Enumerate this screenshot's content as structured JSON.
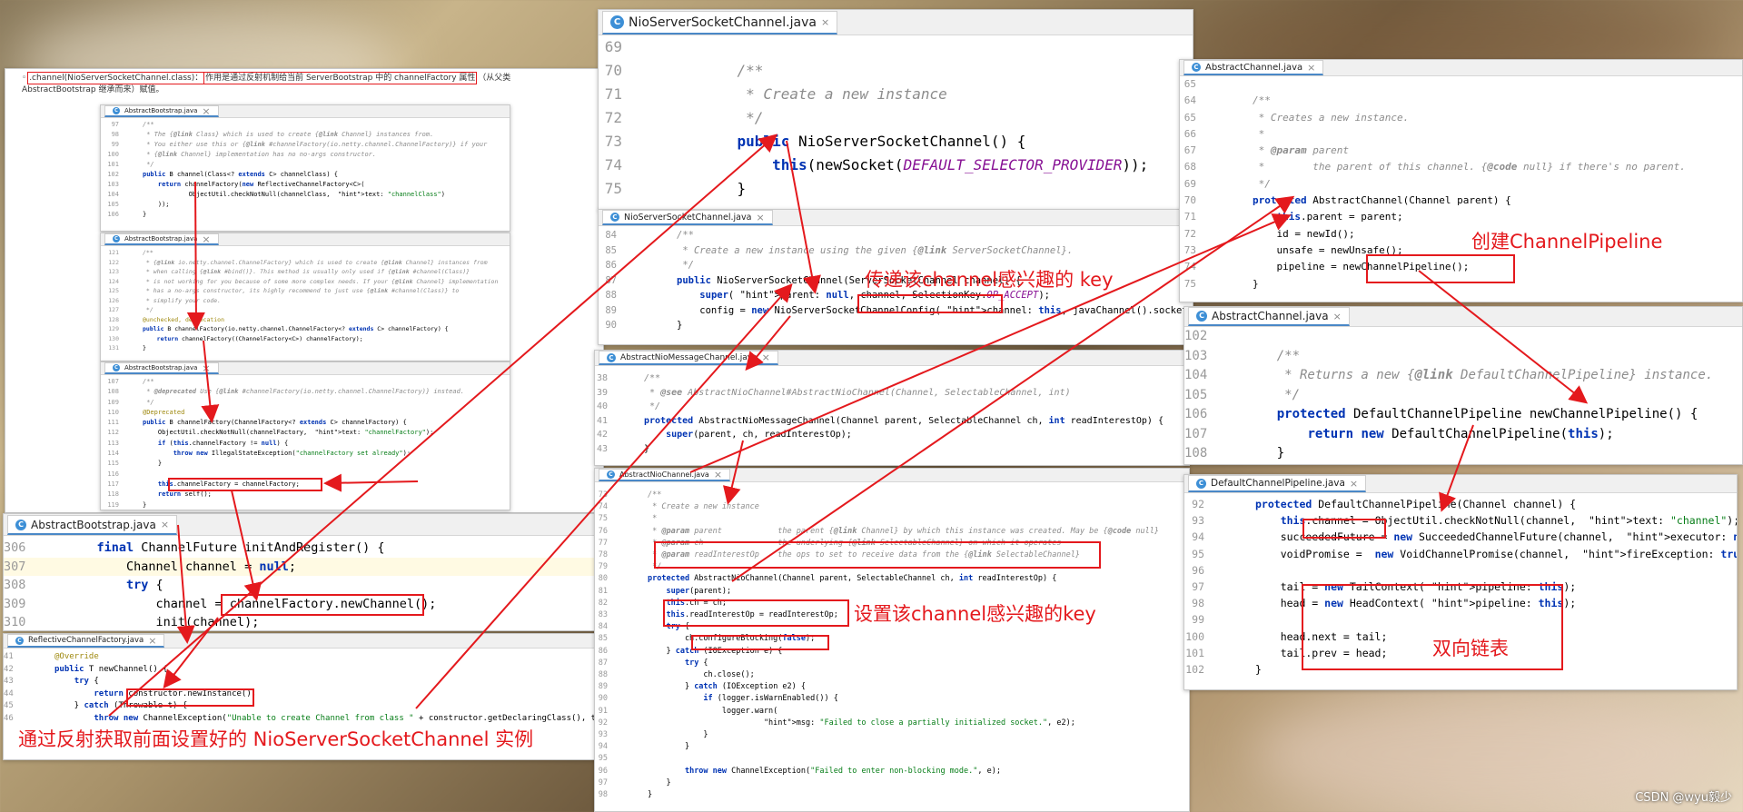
{
  "watermark": "CSDN @wyu毅少",
  "doc_note": {
    "bullet": "◦",
    "prefix": ".channel(NioServerSocketChannel.class)：",
    "text": "作用是通过反射机制给当前 ServerBootstrap 中的 channelFactory 属性",
    "suffix": "（从父类 AbstractBootstrap 继承而来）赋值。"
  },
  "tabs": {
    "abstract_bootstrap": "AbstractBootstrap.java",
    "nio_server_socket_channel": "NioServerSocketChannel.java",
    "abstract_nio_message_channel": "AbstractNioMessageChannel.java",
    "abstract_nio_channel": "AbstractNioChannel.java",
    "reflective_channel_factory": "ReflectiveChannelFactory.java",
    "abstract_channel": "AbstractChannel.java",
    "default_channel_pipeline": "DefaultChannelPipeline.java",
    "close": "×",
    "file_icon": "C"
  },
  "notes": {
    "pass_key": "传递该channel感兴趣的 key",
    "set_key": "设置该channel感兴趣的key",
    "create_pipeline": "创建ChannelPipeline",
    "linked_list": "双向链表",
    "reflect": "通过反射获取前面设置好的 NioServerSocketChannel 实例"
  },
  "ab_small_1": [
    {
      "n": "97",
      "t": "/**"
    },
    {
      "n": "98",
      "t": " * The {@link Class} which is used to create {@link Channel} instances from."
    },
    {
      "n": "99",
      "t": " * You either use this or {@link #channelFactory(io.netty.channel.ChannelFactory)} if your"
    },
    {
      "n": "100",
      "t": " * {@link Channel} implementation has no no-args constructor."
    },
    {
      "n": "101",
      "t": " */"
    },
    {
      "n": "102",
      "t": "public B channel(Class<? extends C> channelClass) {"
    },
    {
      "n": "103",
      "t": "    return channelFactory(new ReflectiveChannelFactory<C>("
    },
    {
      "n": "104",
      "t": "            ObjectUtil.checkNotNull(channelClass,  text: \"channelClass\")"
    },
    {
      "n": "105",
      "t": "    ));"
    },
    {
      "n": "106",
      "t": "}"
    }
  ],
  "ab_small_2": [
    {
      "n": "121",
      "t": "/**"
    },
    {
      "n": "122",
      "t": " * {@link io.netty.channel.ChannelFactory} which is used to create {@link Channel} instances from"
    },
    {
      "n": "123",
      "t": " * when calling {@link #bind()}. This method is usually only used if {@link #channel(Class)}"
    },
    {
      "n": "124",
      "t": " * is not working for you because of some more complex needs. If your {@link Channel} implementation"
    },
    {
      "n": "125",
      "t": " * has a no-args constructor, its highly recommend to just use {@link #channel(Class)} to"
    },
    {
      "n": "126",
      "t": " * simplify your code."
    },
    {
      "n": "127",
      "t": " */"
    },
    {
      "n": "128",
      "t": "@unchecked, deprecation"
    },
    {
      "n": "129",
      "t": "public B channelFactory(io.netty.channel.ChannelFactory<? extends C> channelFactory) {"
    },
    {
      "n": "130",
      "t": "    return channelFactory((ChannelFactory<C>) channelFactory);"
    },
    {
      "n": "131",
      "t": "}"
    }
  ],
  "ab_small_3": [
    {
      "n": "107",
      "t": "/**"
    },
    {
      "n": "108",
      "t": " * @deprecated Use {@link #channelFactory(io.netty.channel.ChannelFactory)} instead."
    },
    {
      "n": "109",
      "t": " */"
    },
    {
      "n": "110",
      "t": "@Deprecated"
    },
    {
      "n": "111",
      "t": "public B channelFactory(ChannelFactory<? extends C> channelFactory) {"
    },
    {
      "n": "112",
      "t": "    ObjectUtil.checkNotNull(channelFactory,  text: \"channelFactory\");"
    },
    {
      "n": "113",
      "t": "    if (this.channelFactory != null) {"
    },
    {
      "n": "114",
      "t": "        throw new IllegalStateException(\"channelFactory set already\");"
    },
    {
      "n": "115",
      "t": "    }"
    },
    {
      "n": "116",
      "t": ""
    },
    {
      "n": "117",
      "t": "    this.channelFactory = channelFactory;"
    },
    {
      "n": "118",
      "t": "    return self();"
    },
    {
      "n": "119",
      "t": "}"
    }
  ],
  "ab_big": [
    {
      "n": "306",
      "t": "    final ChannelFuture initAndRegister() {"
    },
    {
      "n": "307",
      "t": "        Channel channel = null;"
    },
    {
      "n": "308",
      "t": "        try {"
    },
    {
      "n": "309",
      "t": "            channel = channelFactory.newChannel();"
    },
    {
      "n": "310",
      "t": "            init(channel);"
    }
  ],
  "rcf": [
    {
      "n": "41",
      "t": "@Override"
    },
    {
      "n": "42",
      "t": "public T newChannel() {"
    },
    {
      "n": "43",
      "t": "    try {"
    },
    {
      "n": "44",
      "t": "        return constructor.newInstance();"
    },
    {
      "n": "45",
      "t": "    } catch (Throwable t) {"
    },
    {
      "n": "46",
      "t": "        throw new ChannelException(\"Unable to create Channel from class \" + constructor.getDeclaringClass(), t);"
    }
  ],
  "nssc_top": [
    {
      "n": "69",
      "t": ""
    },
    {
      "n": "70",
      "t": "    /**"
    },
    {
      "n": "71",
      "t": "     * Create a new instance"
    },
    {
      "n": "72",
      "t": "     */"
    },
    {
      "n": "73",
      "t": "    public NioServerSocketChannel() {"
    },
    {
      "n": "74",
      "t": "        this(newSocket(DEFAULT_SELECTOR_PROVIDER));"
    },
    {
      "n": "75",
      "t": "    }"
    }
  ],
  "nssc_mid": [
    {
      "n": "84",
      "t": "/**"
    },
    {
      "n": "85",
      "t": " * Create a new instance using the given {@link ServerSocketChannel}."
    },
    {
      "n": "86",
      "t": " */"
    },
    {
      "n": "87",
      "t": "public NioServerSocketChannel(ServerSocketChannel channel) {"
    },
    {
      "n": "88",
      "t": "    super( parent: null, channel, SelectionKey.OP_ACCEPT);"
    },
    {
      "n": "89",
      "t": "    config = new NioServerSocketChannelConfig( channel: this, javaChannel().socket());"
    },
    {
      "n": "90",
      "t": "}"
    }
  ],
  "anmc": [
    {
      "n": "38",
      "t": "/**"
    },
    {
      "n": "39",
      "t": " * @see AbstractNioChannel#AbstractNioChannel(Channel, SelectableChannel, int)"
    },
    {
      "n": "40",
      "t": " */"
    },
    {
      "n": "41",
      "t": "protected AbstractNioMessageChannel(Channel parent, SelectableChannel ch, int readInterestOp) {"
    },
    {
      "n": "42",
      "t": "    super(parent, ch, readInterestOp);"
    },
    {
      "n": "43",
      "t": "}"
    }
  ],
  "anc": [
    {
      "n": "73",
      "t": "/**"
    },
    {
      "n": "74",
      "t": " * Create a new instance"
    },
    {
      "n": "75",
      "t": " *"
    },
    {
      "n": "76",
      "t": " * @param parent            the parent {@link Channel} by which this instance was created. May be {@code null}"
    },
    {
      "n": "77",
      "t": " * @param ch                the underlying {@link SelectableChannel} on which it operates"
    },
    {
      "n": "78",
      "t": " * @param readInterestOp    the ops to set to receive data from the {@link SelectableChannel}"
    },
    {
      "n": "79",
      "t": " */"
    },
    {
      "n": "80",
      "t": "protected AbstractNioChannel(Channel parent, SelectableChannel ch, int readInterestOp) {"
    },
    {
      "n": "81",
      "t": "    super(parent);"
    },
    {
      "n": "82",
      "t": "    this.ch = ch;"
    },
    {
      "n": "83",
      "t": "    this.readInterestOp = readInterestOp;"
    },
    {
      "n": "84",
      "t": "    try {"
    },
    {
      "n": "85",
      "t": "        ch.configureBlocking(false);"
    },
    {
      "n": "86",
      "t": "    } catch (IOException e) {"
    },
    {
      "n": "87",
      "t": "        try {"
    },
    {
      "n": "88",
      "t": "            ch.close();"
    },
    {
      "n": "89",
      "t": "        } catch (IOException e2) {"
    },
    {
      "n": "90",
      "t": "            if (logger.isWarnEnabled()) {"
    },
    {
      "n": "91",
      "t": "                logger.warn("
    },
    {
      "n": "92",
      "t": "                         msg: \"Failed to close a partially initialized socket.\", e2);"
    },
    {
      "n": "93",
      "t": "            }"
    },
    {
      "n": "94",
      "t": "        }"
    },
    {
      "n": "95",
      "t": ""
    },
    {
      "n": "96",
      "t": "        throw new ChannelException(\"Failed to enter non-blocking mode.\", e);"
    },
    {
      "n": "97",
      "t": "    }"
    },
    {
      "n": "98",
      "t": "}"
    }
  ],
  "ac": [
    {
      "n": "65",
      "t": ""
    },
    {
      "n": "64",
      "t": "/**"
    },
    {
      "n": "65",
      "t": " * Creates a new instance."
    },
    {
      "n": "66",
      "t": " *"
    },
    {
      "n": "67",
      "t": " * @param parent"
    },
    {
      "n": "68",
      "t": " *        the parent of this channel. {@code null} if there's no parent."
    },
    {
      "n": "69",
      "t": " */"
    },
    {
      "n": "70",
      "t": "protected AbstractChannel(Channel parent) {"
    },
    {
      "n": "71",
      "t": "    this.parent = parent;"
    },
    {
      "n": "72",
      "t": "    id = newId();"
    },
    {
      "n": "73",
      "t": "    unsafe = newUnsafe();"
    },
    {
      "n": "74",
      "t": "    pipeline = newChannelPipeline();"
    },
    {
      "n": "75",
      "t": "}"
    }
  ],
  "ac2": [
    {
      "n": "102",
      "t": ""
    },
    {
      "n": "103",
      "t": "    /**"
    },
    {
      "n": "104",
      "t": "     * Returns a new {@link DefaultChannelPipeline} instance."
    },
    {
      "n": "105",
      "t": "     */"
    },
    {
      "n": "106",
      "t": "    protected DefaultChannelPipeline newChannelPipeline() {"
    },
    {
      "n": "107",
      "t": "        return new DefaultChannelPipeline(this);"
    },
    {
      "n": "108",
      "t": "    }"
    }
  ],
  "dcp": [
    {
      "n": "92",
      "t": "protected DefaultChannelPipeline(Channel channel) {"
    },
    {
      "n": "93",
      "t": "    this.channel = ObjectUtil.checkNotNull(channel,  text: \"channel\");"
    },
    {
      "n": "94",
      "t": "    succeededFuture = new SucceededChannelFuture(channel,  executor: null);"
    },
    {
      "n": "95",
      "t": "    voidPromise =  new VoidChannelPromise(channel,  fireException: true);"
    },
    {
      "n": "96",
      "t": ""
    },
    {
      "n": "97",
      "t": "    tail = new TailContext( pipeline: this);"
    },
    {
      "n": "98",
      "t": "    head = new HeadContext( pipeline: this);"
    },
    {
      "n": "99",
      "t": ""
    },
    {
      "n": "100",
      "t": "    head.next = tail;"
    },
    {
      "n": "101",
      "t": "    tail.prev = head;"
    },
    {
      "n": "102",
      "t": "}"
    }
  ]
}
